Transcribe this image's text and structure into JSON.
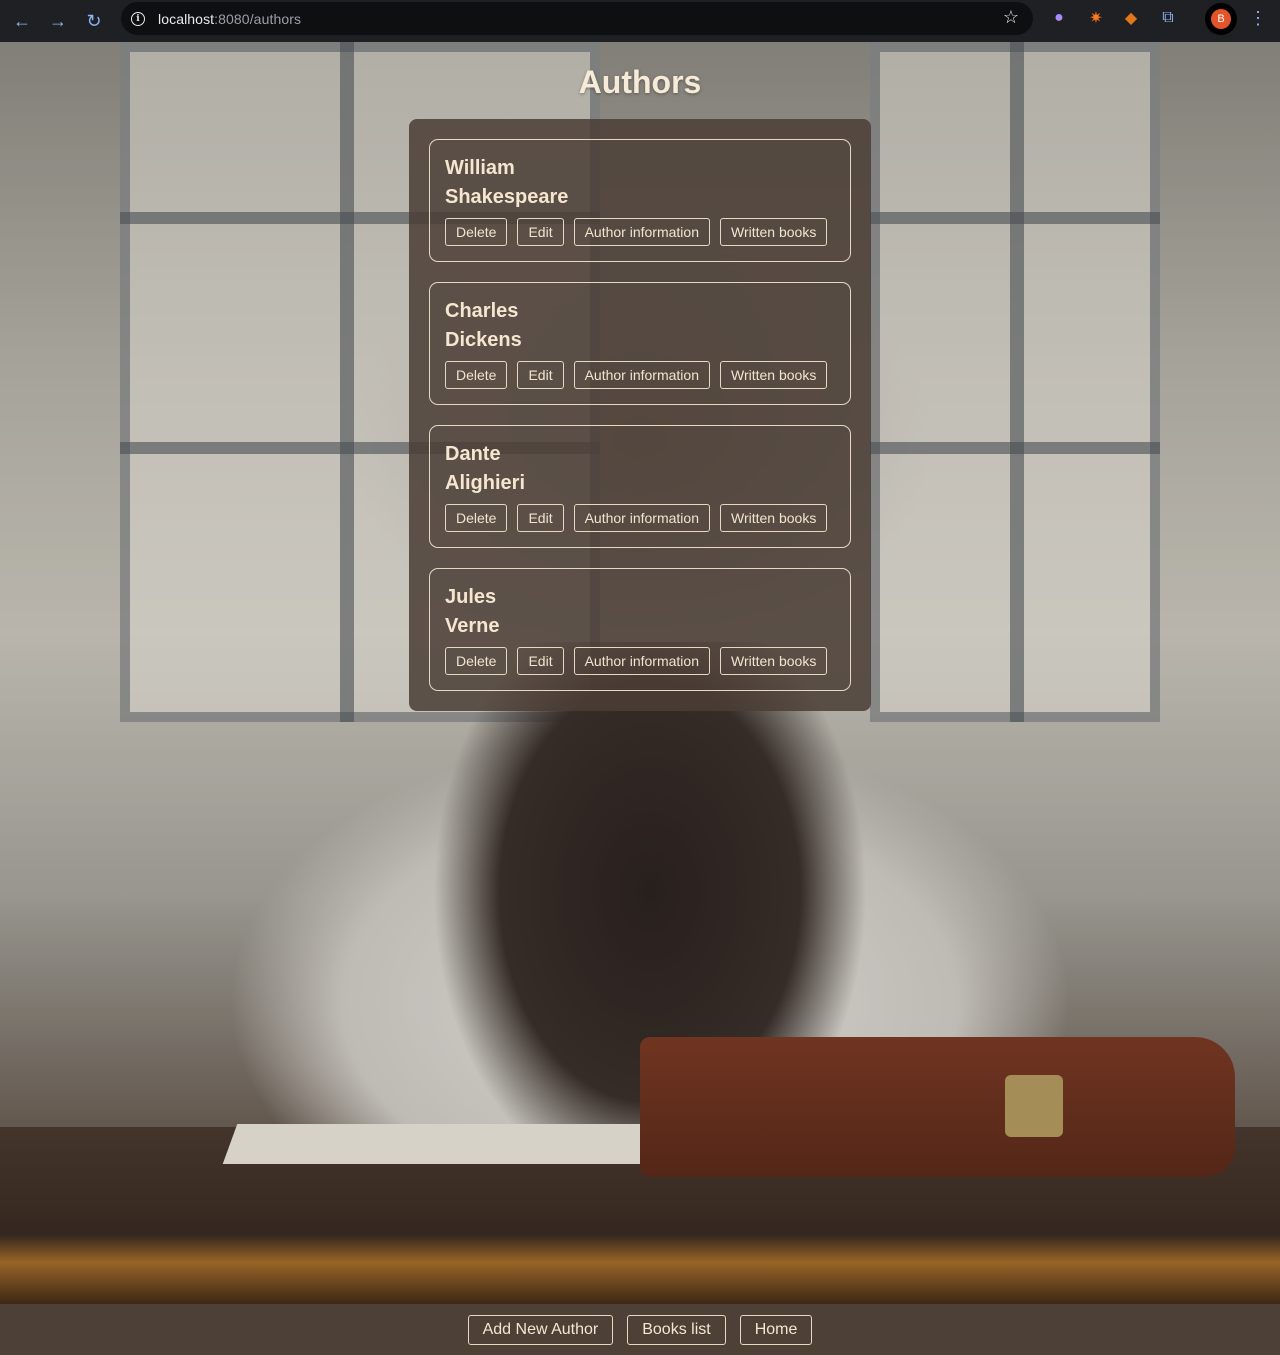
{
  "browser": {
    "url_host": "localhost",
    "url_path": ":8080/authors",
    "profile_initial": "B"
  },
  "page": {
    "title": "Authors"
  },
  "authors": [
    {
      "first": "William",
      "last": "Shakespeare"
    },
    {
      "first": "Charles",
      "last": "Dickens"
    },
    {
      "first": "Dante",
      "last": "Alighieri"
    },
    {
      "first": "Jules",
      "last": "Verne"
    }
  ],
  "actions": {
    "delete": "Delete",
    "edit": "Edit",
    "info": "Author information",
    "books": "Written books"
  },
  "footer": {
    "add_author": "Add New Author",
    "books_list": "Books list",
    "home": "Home"
  },
  "colors": {
    "panel": "#4a3e36",
    "accent_text": "#f4e6cf",
    "border": "#e7d8bf",
    "footer": "#4c4037"
  }
}
